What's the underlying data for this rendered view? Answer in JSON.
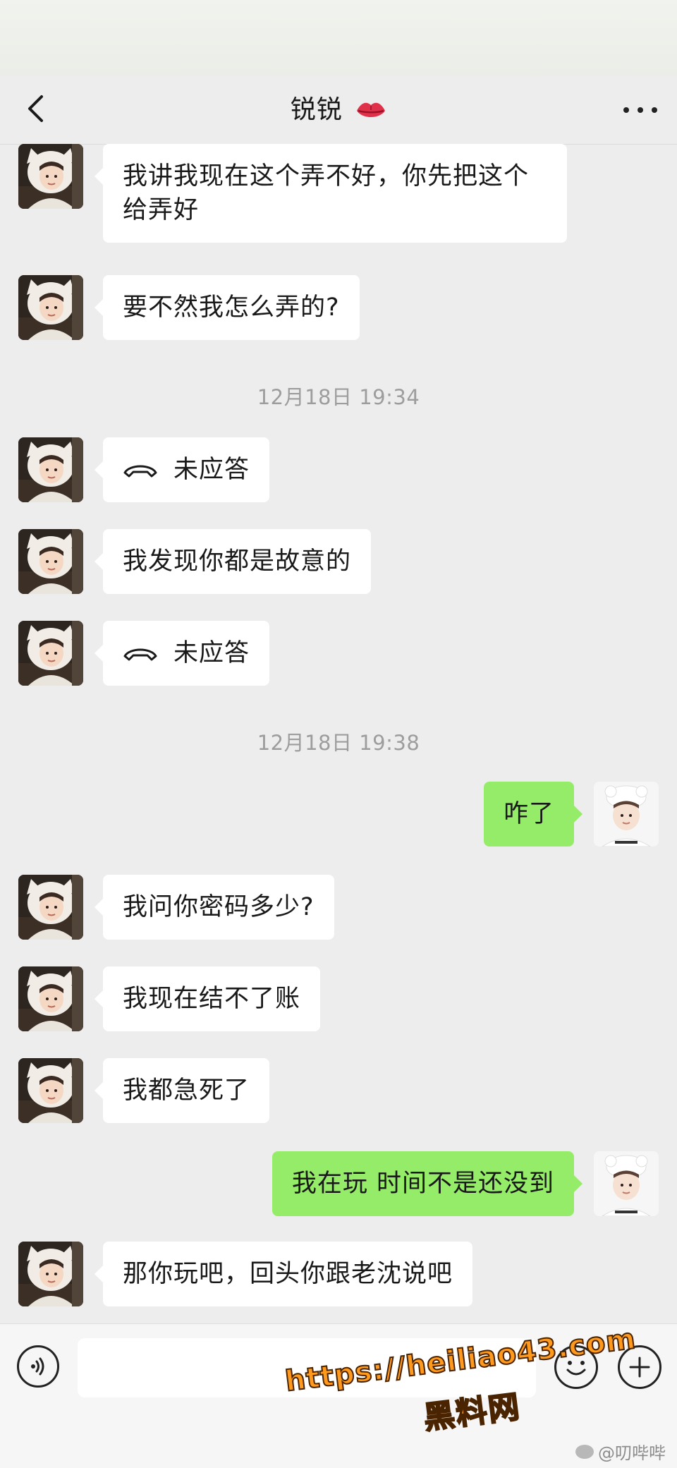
{
  "header": {
    "back_icon": "chevron-left-icon",
    "title": "锐锐",
    "title_icon": "kiss-lips-icon",
    "more_icon": "more-dots-icon"
  },
  "messages": [
    {
      "side": "left",
      "text": "我讲我现在这个弄不好，你先把这个给弄好"
    },
    {
      "side": "left",
      "text": "要不然我怎么弄的?"
    },
    {
      "timestamp": "12月18日 19:34"
    },
    {
      "side": "left",
      "type": "call",
      "text": "未应答"
    },
    {
      "side": "left",
      "text": "我发现你都是故意的"
    },
    {
      "side": "left",
      "type": "call",
      "text": "未应答"
    },
    {
      "timestamp": "12月18日 19:38"
    },
    {
      "side": "right",
      "text": "咋了"
    },
    {
      "side": "left",
      "text": "我问你密码多少?"
    },
    {
      "side": "left",
      "text": "我现在结不了账"
    },
    {
      "side": "left",
      "text": "我都急死了"
    },
    {
      "side": "right",
      "text": "我在玩 时间不是还没到"
    },
    {
      "side": "left",
      "text": "那你玩吧，回头你跟老沈说吧"
    }
  ],
  "input_bar": {
    "voice_icon": "voice-icon",
    "input_value": "",
    "emoji_icon": "emoji-icon",
    "plus_icon": "plus-icon"
  },
  "watermark": {
    "url": "https://heiliao43.com",
    "site": "黑料网",
    "weibo": "@叨哔哔"
  },
  "colors": {
    "background": "#ededed",
    "bubble_left": "#ffffff",
    "bubble_right": "#95ec69",
    "timestamp": "#9d9d9d",
    "watermark": "#ff9a1f"
  }
}
